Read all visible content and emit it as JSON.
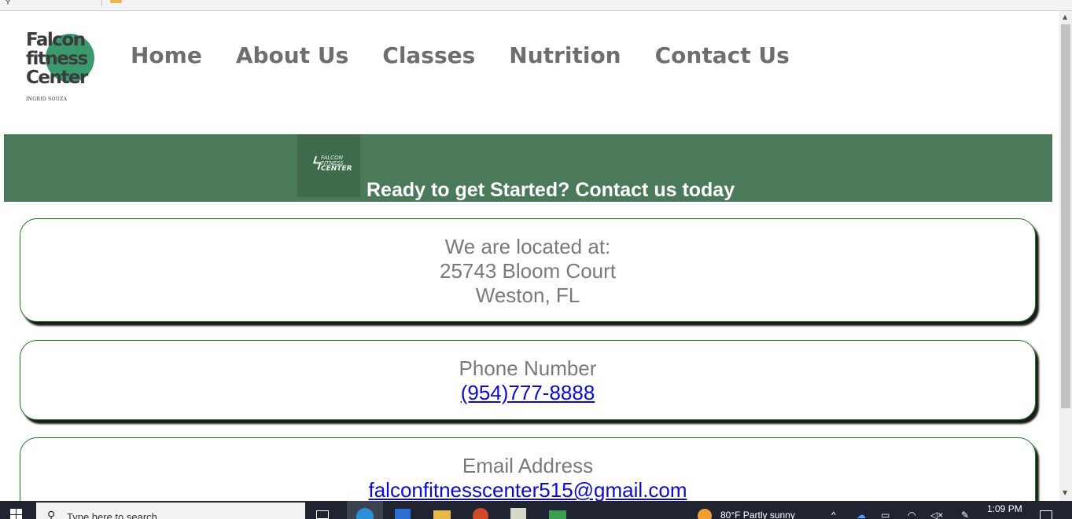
{
  "nav": {
    "items": [
      "Home",
      "About Us",
      "Classes",
      "Nutrition",
      "Contact Us"
    ]
  },
  "logo": {
    "line1": "Falcon",
    "line2": "fitness",
    "line3": "Center",
    "signature": "INGRID SOUZA"
  },
  "banner": {
    "mini_logo_line1": "FALCON",
    "mini_logo_line2": "FITNESS",
    "mini_logo_line3": "CENTER",
    "headline": "Ready to get Started? Contact us today"
  },
  "location": {
    "heading": "We are located at:",
    "street": "25743 Bloom Court",
    "city": "Weston, FL"
  },
  "phone": {
    "heading": "Phone Number",
    "number": "(954)777-8888"
  },
  "email": {
    "heading": "Email Address",
    "address": "falconfitnesscenter515@gmail.com"
  },
  "taskbar": {
    "search_placeholder": "Type here to search",
    "weather": "80°F  Partly sunny",
    "time": "1:09 PM"
  },
  "colors": {
    "banner_green": "#4a7a5a",
    "card_border": "#1a7a1a",
    "nav_text": "#6e6e6e",
    "link_blue": "#0b0bcc"
  }
}
